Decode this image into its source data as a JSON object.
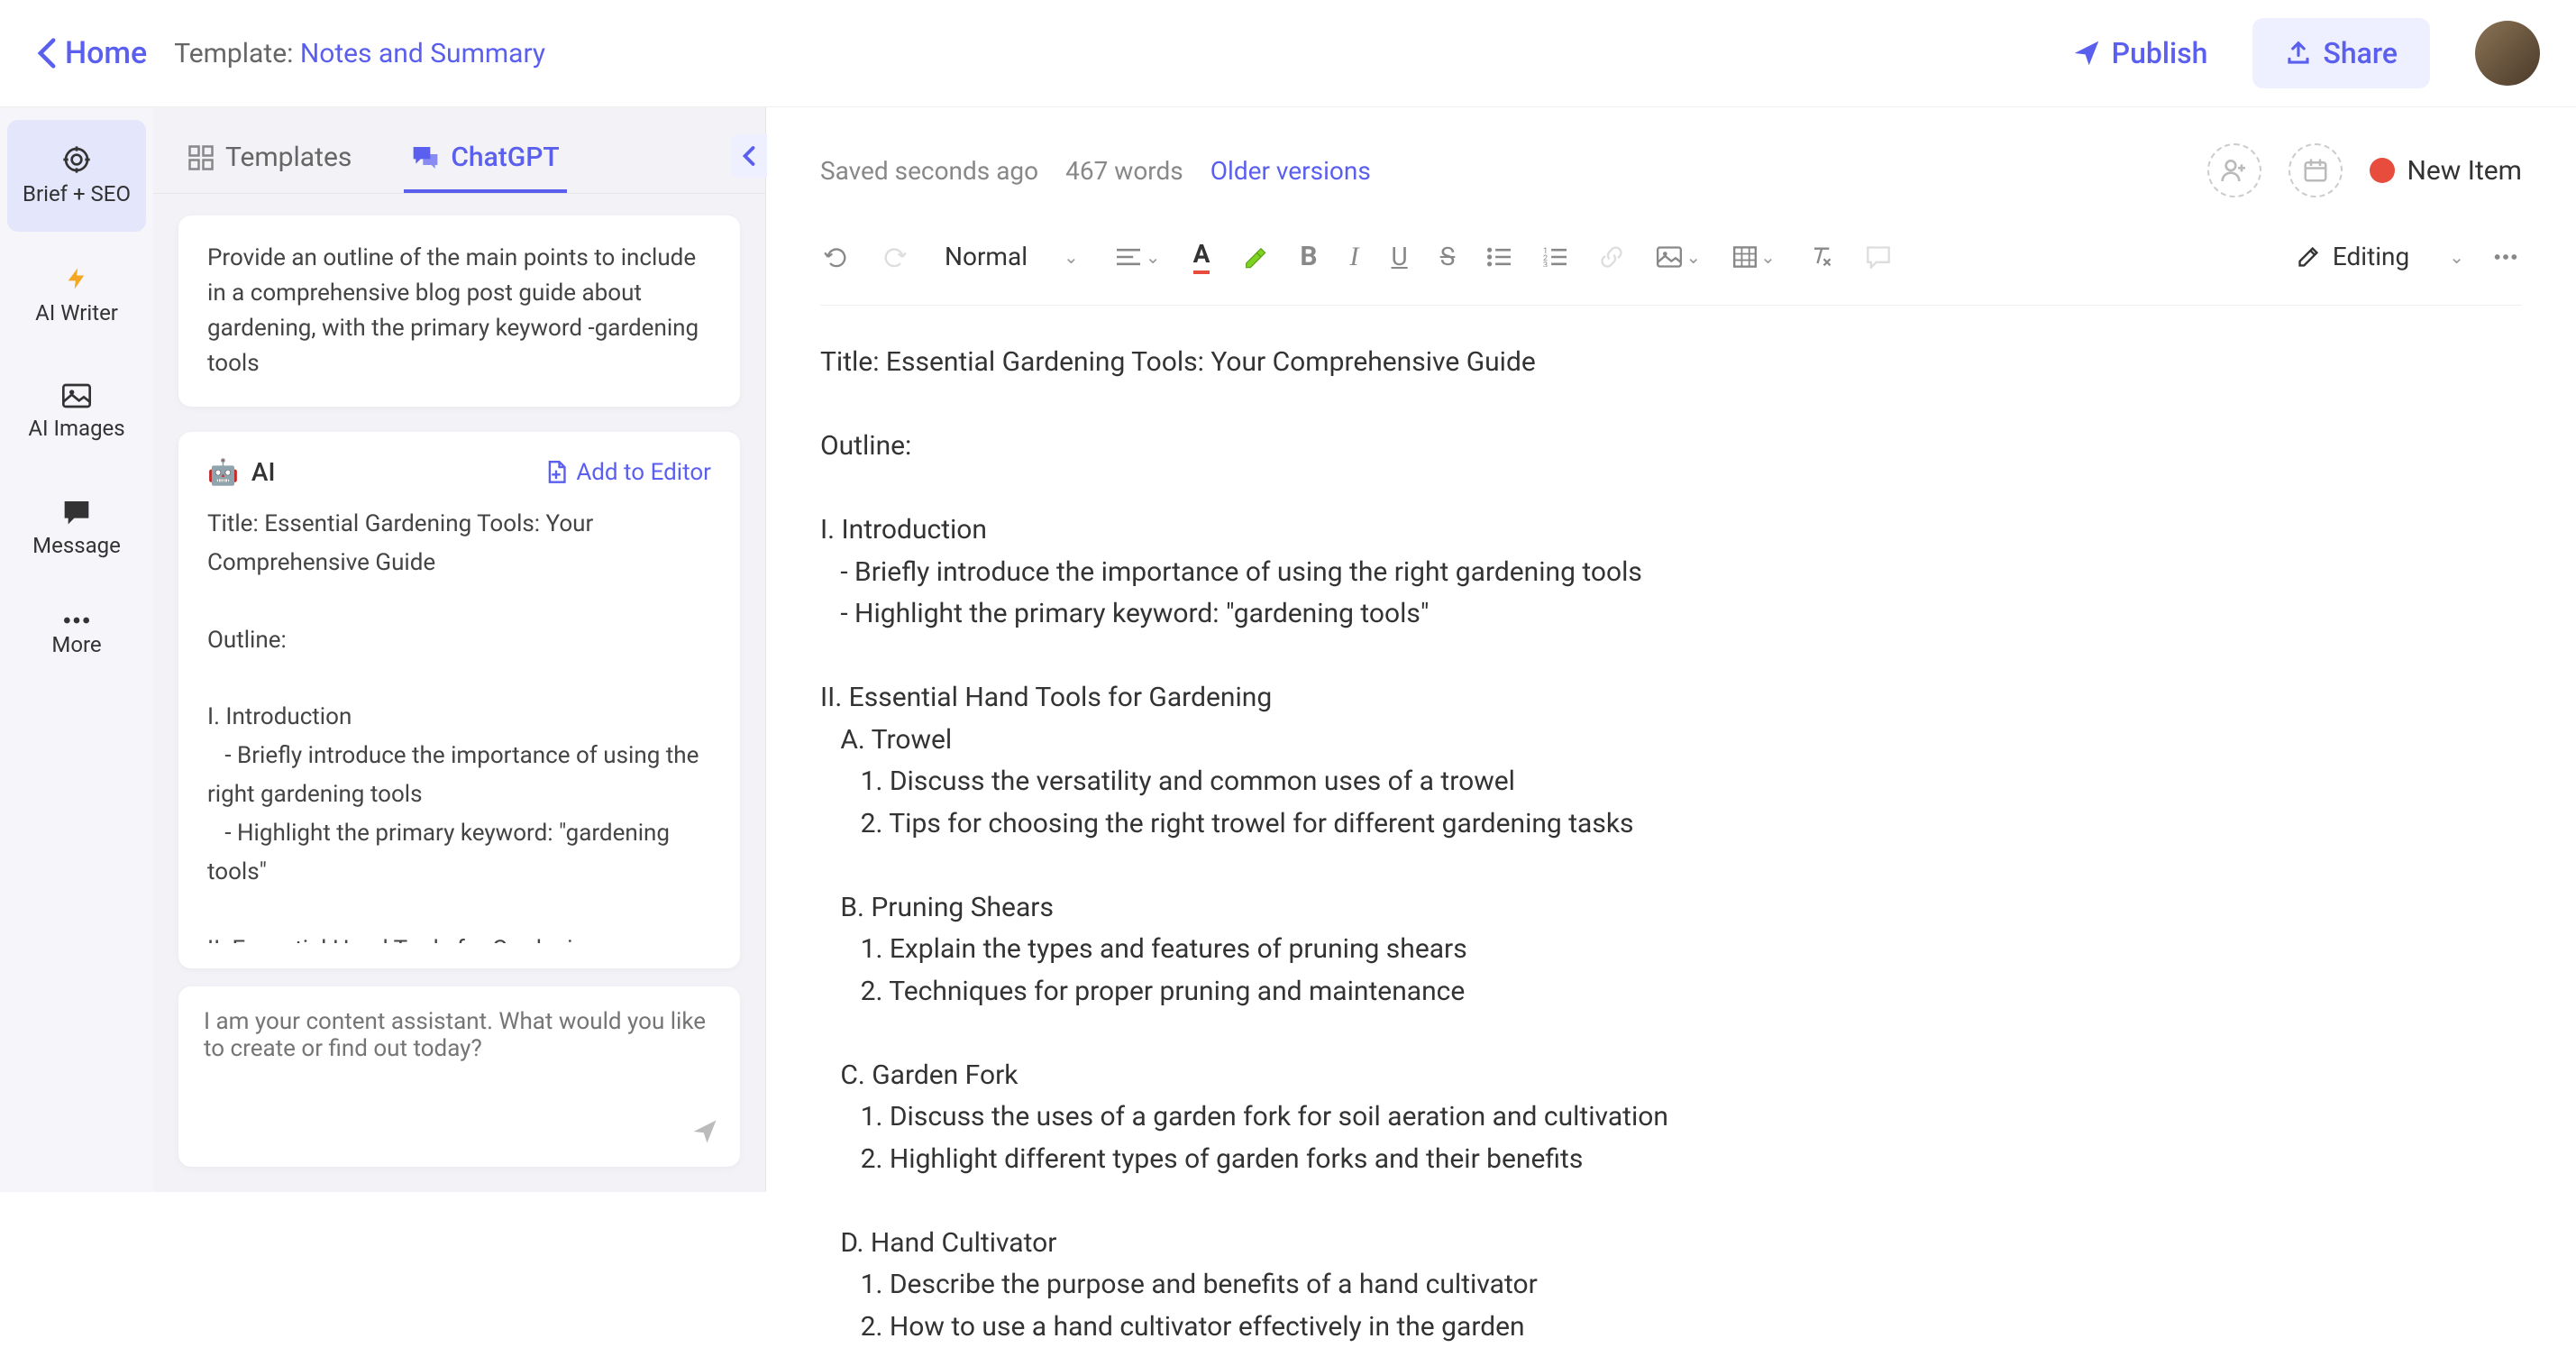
{
  "topbar": {
    "home": "Home",
    "template_prefix": "Template: ",
    "template_name": "Notes and Summary",
    "publish": "Publish",
    "share": "Share"
  },
  "nav": {
    "brief": "Brief + SEO",
    "writer": "AI Writer",
    "images": "AI Images",
    "message": "Message",
    "more": "More"
  },
  "sidebar": {
    "tab_templates": "Templates",
    "tab_chatgpt": "ChatGPT",
    "prompt": "Provide an outline of the main points to include in a comprehensive blog post guide about gardening, with the primary keyword -gardening tools",
    "ai_label": "AI",
    "add_to_editor": "Add to Editor",
    "ai_response": "Title: Essential Gardening Tools: Your Comprehensive Guide\n\nOutline:\n\nI. Introduction\n   - Briefly introduce the importance of using the right gardening tools\n   - Highlight the primary keyword: \"gardening tools\"\n\nII. Essential Hand Tools for Gardening\n   A. Trowel",
    "chat_placeholder": "I am your content assistant. What would you like to create or find out today?"
  },
  "editor_header": {
    "saved": "Saved seconds ago",
    "words": "467 words",
    "older": "Older versions",
    "new_item": "New Item"
  },
  "toolbar": {
    "style": "Normal",
    "editing": "Editing"
  },
  "document": "Title: Essential Gardening Tools: Your Comprehensive Guide\n\nOutline:\n\nI. Introduction\n   - Briefly introduce the importance of using the right gardening tools\n   - Highlight the primary keyword: \"gardening tools\"\n\nII. Essential Hand Tools for Gardening\n   A. Trowel\n      1. Discuss the versatility and common uses of a trowel\n      2. Tips for choosing the right trowel for different gardening tasks\n\n   B. Pruning Shears\n      1. Explain the types and features of pruning shears\n      2. Techniques for proper pruning and maintenance\n\n   C. Garden Fork\n      1. Discuss the uses of a garden fork for soil aeration and cultivation\n      2. Highlight different types of garden forks and their benefits\n\n   D. Hand Cultivator\n      1. Describe the purpose and benefits of a hand cultivator\n      2. How to use a hand cultivator effectively in the garden"
}
